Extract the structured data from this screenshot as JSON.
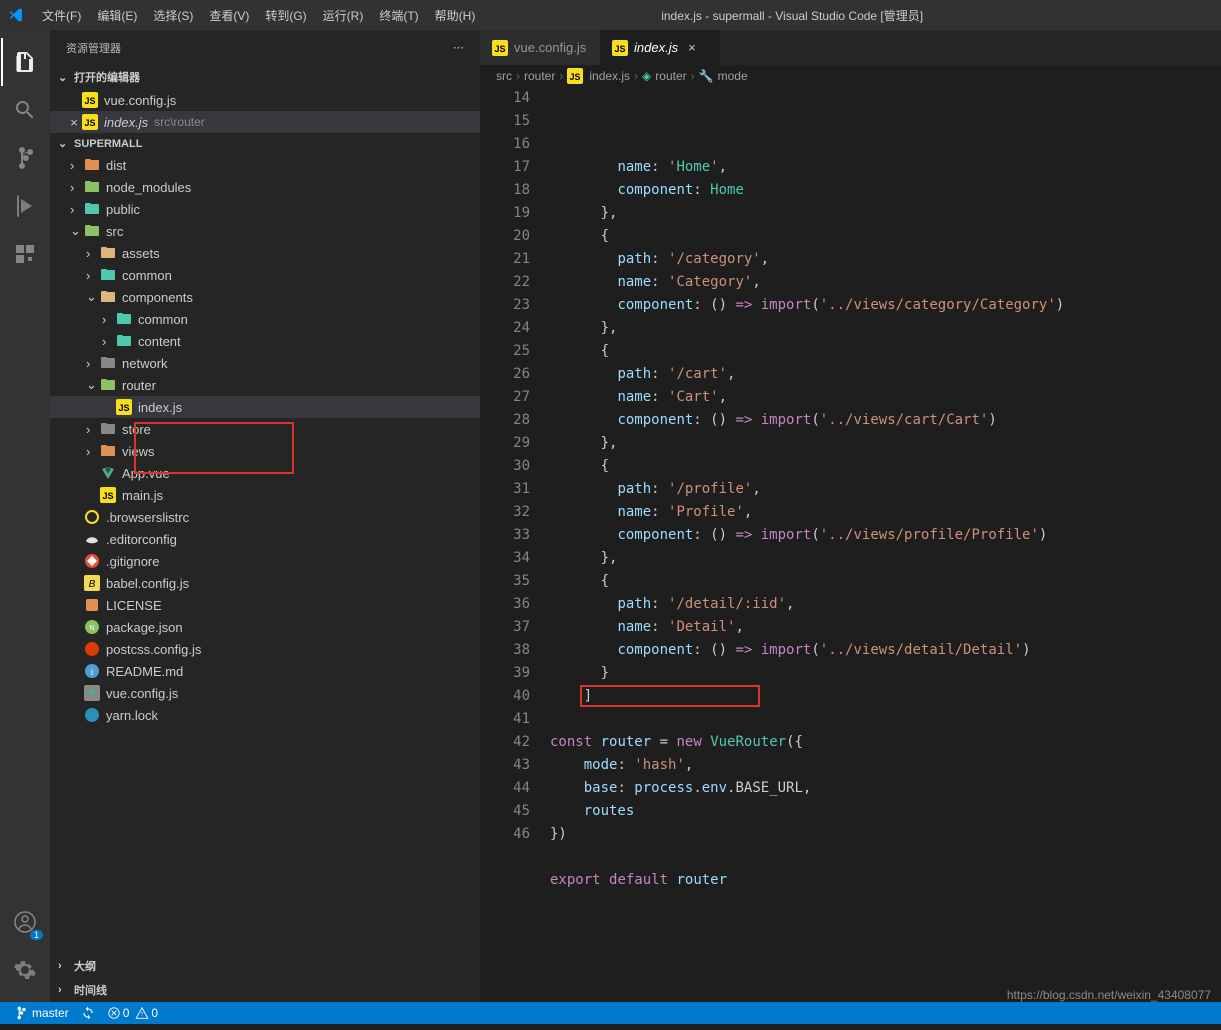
{
  "titlebar": {
    "menus": [
      "文件(F)",
      "编辑(E)",
      "选择(S)",
      "查看(V)",
      "转到(G)",
      "运行(R)",
      "终端(T)",
      "帮助(H)"
    ],
    "title": "index.js - supermall - Visual Studio Code [管理员]"
  },
  "sidebar": {
    "header": "资源管理器",
    "open_editors_label": "打开的编辑器",
    "open_editors": [
      {
        "name": "vue.config.js",
        "icon": "js",
        "close": ""
      },
      {
        "name": "index.js",
        "icon": "js",
        "path": "src\\router",
        "close": "×",
        "active": true
      }
    ],
    "project_label": "SUPERMALL",
    "outline_label": "大纲",
    "timeline_label": "时间线"
  },
  "files": [
    {
      "depth": 0,
      "type": "folder",
      "name": "dist",
      "open": false,
      "color": "#e09050"
    },
    {
      "depth": 0,
      "type": "folder",
      "name": "node_modules",
      "open": false,
      "color": "#8cc265"
    },
    {
      "depth": 0,
      "type": "folder",
      "name": "public",
      "open": false,
      "color": "#4ec9b0"
    },
    {
      "depth": 0,
      "type": "folder",
      "name": "src",
      "open": true,
      "color": "#8cc265"
    },
    {
      "depth": 1,
      "type": "folder",
      "name": "assets",
      "open": false,
      "color": "#dcb67a"
    },
    {
      "depth": 1,
      "type": "folder",
      "name": "common",
      "open": false,
      "color": "#4ec9b0"
    },
    {
      "depth": 1,
      "type": "folder",
      "name": "components",
      "open": true,
      "color": "#dcb67a"
    },
    {
      "depth": 2,
      "type": "folder",
      "name": "common",
      "open": false,
      "color": "#4ec9b0"
    },
    {
      "depth": 2,
      "type": "folder",
      "name": "content",
      "open": false,
      "color": "#4ec9b0"
    },
    {
      "depth": 1,
      "type": "folder",
      "name": "network",
      "open": false,
      "color": "#888"
    },
    {
      "depth": 1,
      "type": "folder",
      "name": "router",
      "open": true,
      "color": "#8cc265",
      "highlight": true
    },
    {
      "depth": 2,
      "type": "file",
      "name": "index.js",
      "icon": "js",
      "active": true,
      "highlight": true
    },
    {
      "depth": 1,
      "type": "folder",
      "name": "store",
      "open": false,
      "color": "#888"
    },
    {
      "depth": 1,
      "type": "folder",
      "name": "views",
      "open": false,
      "color": "#e09050"
    },
    {
      "depth": 1,
      "type": "file",
      "name": "App.vue",
      "icon": "vue"
    },
    {
      "depth": 1,
      "type": "file",
      "name": "main.js",
      "icon": "js"
    },
    {
      "depth": 0,
      "type": "file",
      "name": ".browserslistrc",
      "icon": "browserslist"
    },
    {
      "depth": 0,
      "type": "file",
      "name": ".editorconfig",
      "icon": "editorconfig"
    },
    {
      "depth": 0,
      "type": "file",
      "name": ".gitignore",
      "icon": "git"
    },
    {
      "depth": 0,
      "type": "file",
      "name": "babel.config.js",
      "icon": "babel"
    },
    {
      "depth": 0,
      "type": "file",
      "name": "LICENSE",
      "icon": "license"
    },
    {
      "depth": 0,
      "type": "file",
      "name": "package.json",
      "icon": "npm"
    },
    {
      "depth": 0,
      "type": "file",
      "name": "postcss.config.js",
      "icon": "postcss"
    },
    {
      "depth": 0,
      "type": "file",
      "name": "README.md",
      "icon": "readme"
    },
    {
      "depth": 0,
      "type": "file",
      "name": "vue.config.js",
      "icon": "vueconf"
    },
    {
      "depth": 0,
      "type": "file",
      "name": "yarn.lock",
      "icon": "yarn"
    }
  ],
  "tabs": [
    {
      "name": "vue.config.js",
      "icon": "js",
      "active": false
    },
    {
      "name": "index.js",
      "icon": "js",
      "active": true
    }
  ],
  "breadcrumbs": [
    "src",
    "router",
    "index.js",
    "router",
    "mode"
  ],
  "code_start_line": 14,
  "code_lines": [
    "        name: 'Home',",
    "        component: Home",
    "      },",
    "      {",
    "        path: '/category',",
    "        name: 'Category',",
    "        component: () => import('../views/category/Category')",
    "      },",
    "      {",
    "        path: '/cart',",
    "        name: 'Cart',",
    "        component: () => import('../views/cart/Cart')",
    "      },",
    "      {",
    "        path: '/profile',",
    "        name: 'Profile',",
    "        component: () => import('../views/profile/Profile')",
    "      },",
    "      {",
    "        path: '/detail/:iid',",
    "        name: 'Detail',",
    "        component: () => import('../views/detail/Detail')",
    "      }",
    "    ]",
    "",
    "const router = new VueRouter({",
    "    mode: 'hash',",
    "    base: process.env.BASE_URL,",
    "    routes",
    "})",
    "",
    "export default router",
    ""
  ],
  "statusbar": {
    "branch": "master",
    "errors": "0",
    "warnings": "0"
  },
  "footer": "https://blog.csdn.net/weixin_43408077"
}
